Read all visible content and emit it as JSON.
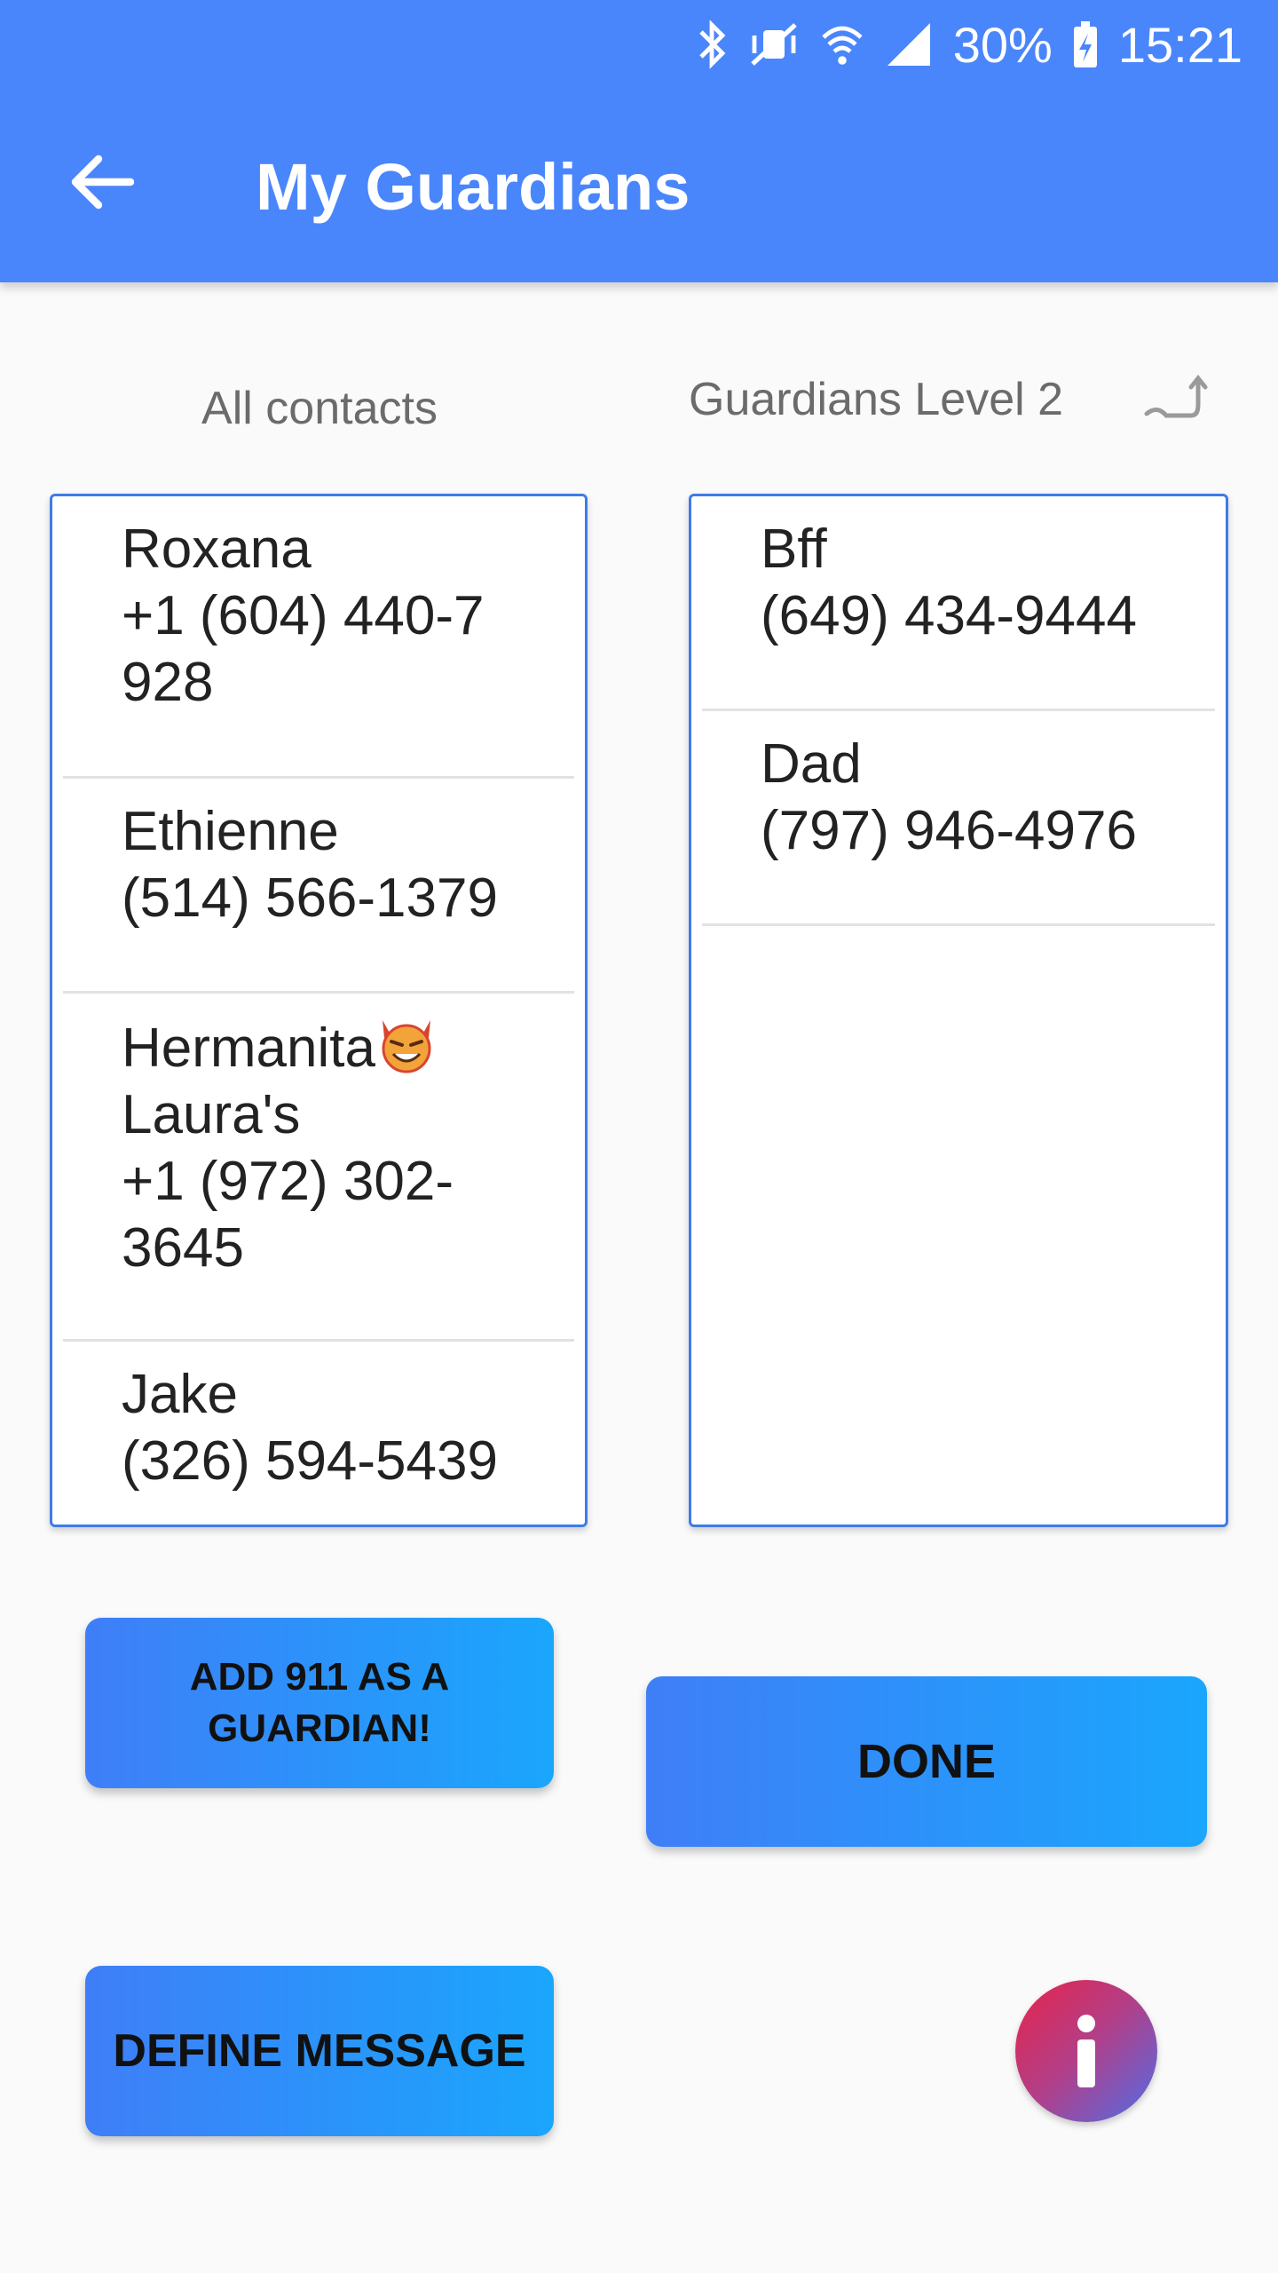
{
  "status_bar": {
    "battery": "30%",
    "time": "15:21",
    "icons": [
      "bluetooth-icon",
      "mute-vibrate-icon",
      "wifi-icon",
      "signal-icon",
      "battery-charging-icon"
    ]
  },
  "app_bar": {
    "title": "My Guardians",
    "back_icon": "arrow-left-icon",
    "color": "#4a86fb"
  },
  "columns": {
    "left_header": "All contacts",
    "right_header": "Guardians Level 2",
    "level_icon": "curved-arrow-icon"
  },
  "all_contacts": [
    {
      "name": "Roxana",
      "phone": "+1 (604) 440-7 928"
    },
    {
      "name": "Ethienne",
      "phone": "(514) 566-1379"
    },
    {
      "name": "Hermanita",
      "extra": "Laura's",
      "phone": "+1 (972) 302-3645",
      "emoji": "smiling-devil-emoji"
    },
    {
      "name": "Jake",
      "phone": "(326) 594-5439"
    }
  ],
  "guardians": [
    {
      "name": "Bff",
      "phone": "(649) 434-9444"
    },
    {
      "name": "Dad",
      "phone": "(797) 946-4976"
    }
  ],
  "buttons": {
    "add_911": "ADD 911 AS A GUARDIAN!",
    "done": "DONE",
    "define_message": "DEFINE MESSAGE"
  },
  "info_button": {
    "icon": "info-icon"
  }
}
